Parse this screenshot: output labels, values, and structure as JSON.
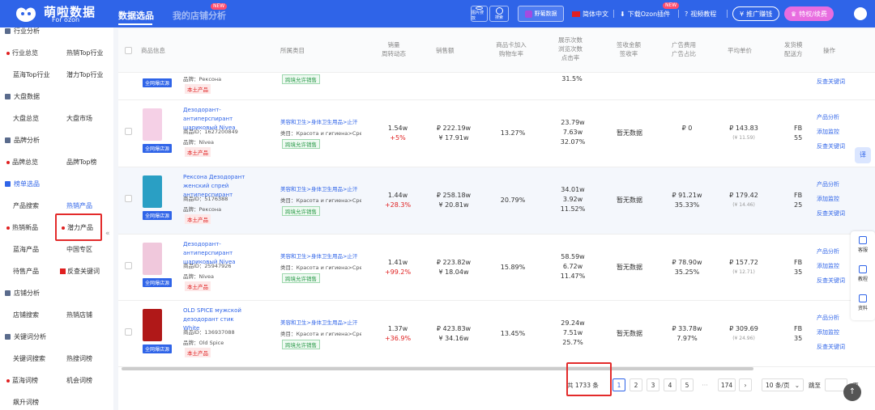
{
  "header": {
    "brand": "萌啦数据",
    "brand_sub": "For ozon",
    "nav_active": "数据选品",
    "nav_second": "我的店铺分析",
    "new_badge": "NEW",
    "img_search": "图片搜款",
    "search": "搜索",
    "grape": "野葡数据",
    "lang": "简体中文",
    "download": "下载Ozon插件",
    "download_new": "NEW",
    "video": "视频教程",
    "promo": "推广赚钱",
    "vip": "特权/续费"
  },
  "sidebar": {
    "s1": "行业分析",
    "i1a": "行业总览",
    "i1b": "热销Top行业",
    "i1c": "蓝海Top行业",
    "i1d": "潜力Top行业",
    "s2": "大盘数据",
    "i2a": "大盘总览",
    "i2b": "大盘市场",
    "s3": "品牌分析",
    "i3a": "品牌总览",
    "i3b": "品牌Top榜",
    "s4": "榜单选品",
    "i4a": "产品搜索",
    "i4b": "热销产品",
    "i4c": "热销新品",
    "i4d": "潜力产品",
    "i4e": "蓝海产品",
    "i4f": "中国专区",
    "i4g": "待售产品",
    "i4h": "反查关键词",
    "s5": "店铺分析",
    "i5a": "店铺搜索",
    "i5b": "热销店铺",
    "s6": "关键词分析",
    "i6a": "关键词搜索",
    "i6b": "热搜词榜",
    "i6c": "蓝海词榜",
    "i6d": "机会词榜",
    "i6e": "飙升词榜"
  },
  "table": {
    "headers": {
      "product": "商品信息",
      "category": "所属类目",
      "sales": "销量\n周转动态",
      "amount": "销售额",
      "cart": "商品卡加入\n购物车率",
      "impressions": "展示次数\n浏览次数\n点击率",
      "sign": "签收金额\n签收率",
      "ad": "广告费用\n广告占比",
      "price": "平均单价",
      "ship": "发货模\n配送方",
      "op": "操作"
    },
    "top_partial": {
      "tag": "全网爆店源",
      "brand": "品牌：Рексона",
      "local": "本土产品",
      "cross": "跨境允许销售",
      "pct": "31.5%",
      "a3": "反查关键词"
    },
    "rows": [
      {
        "name": "Дезодорант-антиперспирант шариковый Nivea",
        "id": "商品ID：1627200849",
        "brand": "品牌：Nivea",
        "tag": "全网爆店源",
        "local": "本土产品",
        "cat": "美容和卫生>身体卫生用品>止汗",
        "cat2": "类目：Красота и гигиена>Средства",
        "cross": "跨境允许销售",
        "sales": "1.54w",
        "trend": "+5%",
        "amt": "₽ 222.19w",
        "amt2": "¥ 17.91w",
        "cart": "13.27%",
        "imp": "23.79w",
        "view": "7.63w",
        "ctr": "32.07%",
        "sign": "暂无数据",
        "ad": "₽ 0",
        "ad2": "",
        "price": "₽ 143.83",
        "price2": "(¥ 11.59)",
        "ship": "FB",
        "ship2": "55",
        "a1": "产品分析",
        "a2": "添加监控",
        "a3": "反查关键词",
        "color": "#f5d0e6"
      },
      {
        "name": "Рексона Дезодорант женский спрей антиперспирант",
        "id": "商品ID：5176388",
        "brand": "品牌：Рексона",
        "tag": "全网爆店源",
        "local": "本土产品",
        "cat": "美容和卫生>身体卫生用品>止汗",
        "cat2": "类目：Красота и гигиена>Средства",
        "cross": "跨境允许销售",
        "sales": "1.44w",
        "trend": "+28.3%",
        "amt": "₽ 258.18w",
        "amt2": "¥ 20.81w",
        "cart": "20.79%",
        "imp": "34.01w",
        "view": "3.92w",
        "ctr": "11.52%",
        "sign": "暂无数据",
        "ad": "₽ 91.21w",
        "ad2": "35.33%",
        "price": "₽ 179.42",
        "price2": "(¥ 14.46)",
        "ship": "FB",
        "ship2": "25",
        "a1": "产品分析",
        "a2": "添加监控",
        "a3": "反查关键词",
        "color": "#2a9fc4"
      },
      {
        "name": "Дезодорант-антиперспирант шариковый Nivea",
        "id": "商品ID：25947926",
        "brand": "品牌：Nivea",
        "tag": "全网爆店源",
        "local": "本土产品",
        "cat": "美容和卫生>身体卫生用品>止汗",
        "cat2": "类目：Красота и гигиена>Средства",
        "cross": "跨境允许销售",
        "sales": "1.41w",
        "trend": "+99.2%",
        "amt": "₽ 223.82w",
        "amt2": "¥ 18.04w",
        "cart": "15.89%",
        "imp": "58.59w",
        "view": "6.72w",
        "ctr": "11.47%",
        "sign": "暂无数据",
        "ad": "₽ 78.90w",
        "ad2": "35.25%",
        "price": "₽ 157.72",
        "price2": "(¥ 12.71)",
        "ship": "FB",
        "ship2": "35",
        "a1": "产品分析",
        "a2": "添加监控",
        "a3": "反查关键词",
        "color": "#f0c8dc"
      },
      {
        "name": "OLD SPICE мужской дезодорант стик White",
        "id": "商品ID：136937088",
        "brand": "品牌：Old Spice",
        "tag": "全网爆店源",
        "local": "本土产品",
        "cat": "美容和卫生>身体卫生用品>止汗",
        "cat2": "类目：Красота и гигиена>Средства",
        "cross": "跨境允许销售",
        "sales": "1.37w",
        "trend": "+36.9%",
        "amt": "₽ 423.83w",
        "amt2": "¥ 34.16w",
        "cart": "13.45%",
        "imp": "29.24w",
        "view": "7.51w",
        "ctr": "25.7%",
        "sign": "暂无数据",
        "ad": "₽ 33.78w",
        "ad2": "7.97%",
        "price": "₽ 309.69",
        "price2": "(¥ 24.96)",
        "ship": "FB",
        "ship2": "35",
        "a1": "产品分析",
        "a2": "添加监控",
        "a3": "反查关键词",
        "color": "#b01818"
      }
    ]
  },
  "pager": {
    "total": "共 1733 条",
    "p1": "1",
    "p2": "2",
    "p3": "3",
    "p4": "4",
    "p5": "5",
    "dots": "···",
    "plast": "174",
    "per": "10 条/页",
    "goto": "跳至",
    "page_suffix": "页"
  },
  "right": {
    "tab": "译",
    "t1": "客服",
    "t2": "教程",
    "t3": "资料",
    "top": "↑"
  }
}
